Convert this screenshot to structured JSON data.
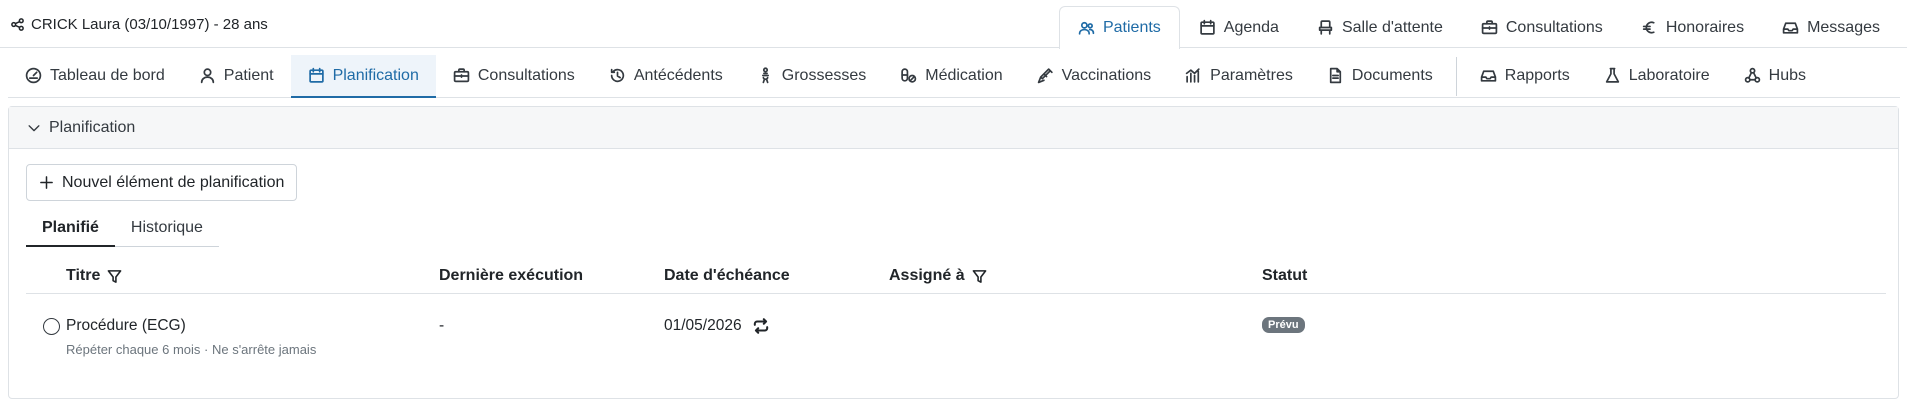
{
  "header": {
    "patient": "CRICK Laura (03/10/1997) - 28 ans",
    "app_tabs": [
      {
        "label": "Patients",
        "icon": "users-icon",
        "active": true
      },
      {
        "label": "Agenda",
        "icon": "calendar-icon"
      },
      {
        "label": "Salle d'attente",
        "icon": "chair-icon"
      },
      {
        "label": "Consultations",
        "icon": "briefcase-icon"
      },
      {
        "label": "Honoraires",
        "icon": "euro-icon"
      },
      {
        "label": "Messages",
        "icon": "inbox-icon"
      }
    ]
  },
  "section_tabs": [
    {
      "label": "Tableau de bord",
      "icon": "dashboard-icon"
    },
    {
      "label": "Patient",
      "icon": "person-icon"
    },
    {
      "label": "Planification",
      "icon": "calendar-icon",
      "active": true
    },
    {
      "label": "Consultations",
      "icon": "briefcase-icon"
    },
    {
      "label": "Antécédents",
      "icon": "history-icon"
    },
    {
      "label": "Grossesses",
      "icon": "pregnancy-icon"
    },
    {
      "label": "Médication",
      "icon": "pills-icon"
    },
    {
      "label": "Vaccinations",
      "icon": "syringe-icon"
    },
    {
      "label": "Paramètres",
      "icon": "chart-icon"
    },
    {
      "label": "Documents",
      "icon": "document-icon"
    },
    {
      "label": "Rapports",
      "icon": "inbox-icon"
    },
    {
      "label": "Laboratoire",
      "icon": "flask-icon"
    },
    {
      "label": "Hubs",
      "icon": "hubs-icon"
    }
  ],
  "panel": {
    "title": "Planification",
    "new_button": "Nouvel élément de planification",
    "subtabs": [
      "Planifié",
      "Historique"
    ],
    "columns": {
      "title": "Titre",
      "last": "Dernière exécution",
      "due": "Date d'échéance",
      "assigned": "Assigné à",
      "status": "Statut"
    },
    "rows": [
      {
        "title": "Procédure (ECG)",
        "detail": "Répéter chaque 6 mois · Ne s'arrête jamais",
        "last": "-",
        "due": "01/05/2026",
        "assigned": "",
        "status": "Prévu"
      }
    ]
  },
  "colors": {
    "accent": "#1f6ba6",
    "active_bg": "#eef4fa",
    "badge": "#6c757d"
  }
}
